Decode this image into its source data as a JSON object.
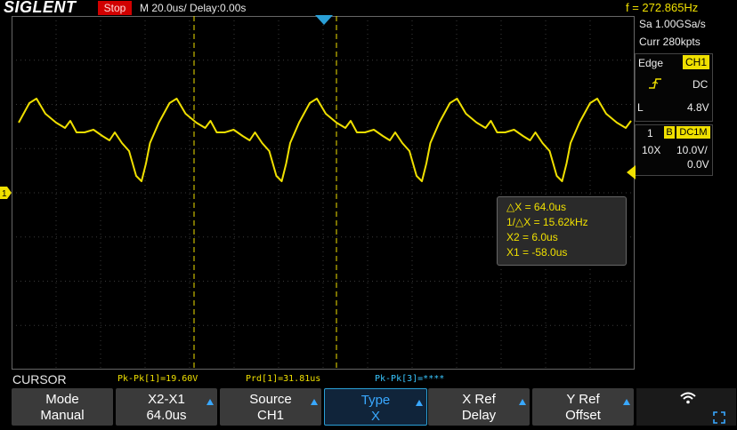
{
  "header": {
    "logo": "SIGLENT",
    "status": "Stop",
    "timebase": "M 20.0us/  Delay:0.00s",
    "frequency": "f = 272.865Hz"
  },
  "acquisition": {
    "sample_rate": "Sa 1.00GSa/s",
    "memory": "Curr 280kpts"
  },
  "trigger": {
    "type": "Edge",
    "source": "CH1",
    "slope_icon": "rising-edge-icon",
    "coupling": "DC",
    "level_label": "L",
    "level": "4.8V"
  },
  "channel": {
    "number": "1",
    "bw_limit": "B",
    "impedance": "DC1M",
    "probe": "10X",
    "volts_div": "10.0V/",
    "offset": "0.0V",
    "color": "#f0e000",
    "ground_marker": "1"
  },
  "cursor_readout": {
    "delta_x": "△X = 64.0us",
    "inv_delta_x": "1/△X = 15.62kHz",
    "x2": "X2 = 6.0us",
    "x1": "X1 = -58.0us"
  },
  "menu": {
    "title": "CURSOR",
    "measurements": [
      {
        "text": "Pk-Pk[1]=19.60V",
        "color": "#f0e000"
      },
      {
        "text": "Prd[1]=31.81us",
        "color": "#f0e000"
      },
      {
        "text": "Pk-Pk[3]=****",
        "color": "#39c6ff"
      }
    ],
    "softkeys": [
      {
        "line1": "Mode",
        "line2": "Manual",
        "arrow": false
      },
      {
        "line1": "X2-X1",
        "line2": "64.0us",
        "arrow": true
      },
      {
        "line1": "Source",
        "line2": "CH1",
        "arrow": true
      },
      {
        "line1": "Type",
        "line2": "X",
        "arrow": true
      },
      {
        "line1": "X Ref",
        "line2": "Delay",
        "arrow": true
      },
      {
        "line1": "Y Ref",
        "line2": "Offset",
        "arrow": true
      }
    ]
  },
  "colors": {
    "trace": "#f0e000",
    "accent": "#39a8ff",
    "stop": "#d10000"
  }
}
